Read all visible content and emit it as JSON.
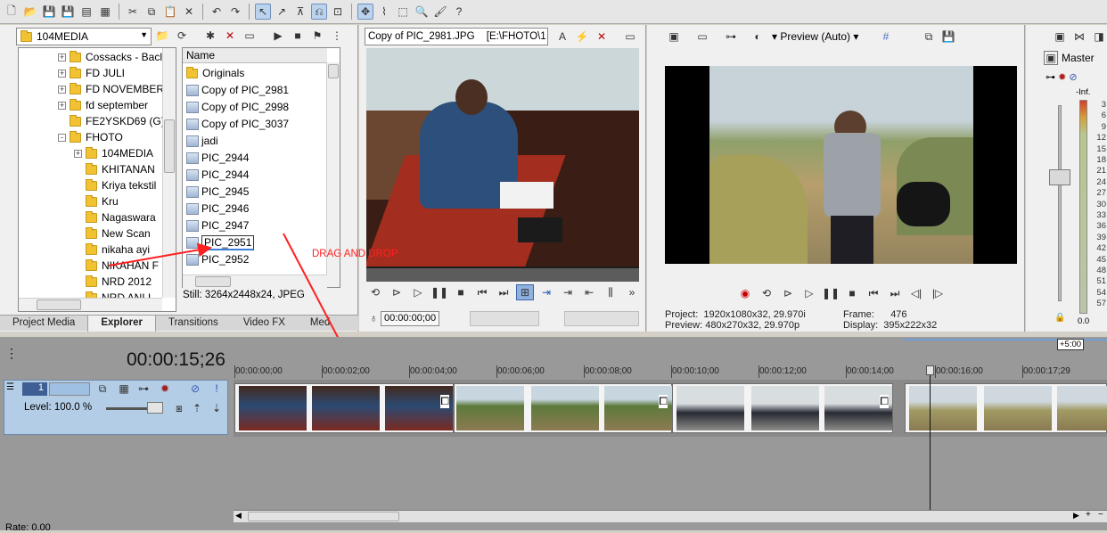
{
  "explorer": {
    "location": "104MEDIA",
    "tree": [
      {
        "label": "Cossacks - Bacl",
        "indent": 1,
        "exp": "+"
      },
      {
        "label": "FD JULI",
        "indent": 1,
        "exp": "+"
      },
      {
        "label": "FD NOVEMBER",
        "indent": 1,
        "exp": "+"
      },
      {
        "label": "fd september",
        "indent": 1,
        "exp": "+"
      },
      {
        "label": "FE2YSKD69 (G)",
        "indent": 1,
        "exp": ""
      },
      {
        "label": "FHOTO",
        "indent": 1,
        "exp": "-"
      },
      {
        "label": "104MEDIA",
        "indent": 2,
        "exp": "+"
      },
      {
        "label": "KHITANAN",
        "indent": 2,
        "exp": ""
      },
      {
        "label": "Kriya tekstil",
        "indent": 2,
        "exp": ""
      },
      {
        "label": "Kru",
        "indent": 2,
        "exp": ""
      },
      {
        "label": "Nagaswara",
        "indent": 2,
        "exp": ""
      },
      {
        "label": "New Scan",
        "indent": 2,
        "exp": ""
      },
      {
        "label": "nikaha ayi",
        "indent": 2,
        "exp": ""
      },
      {
        "label": "NIKAHAN F",
        "indent": 2,
        "exp": ""
      },
      {
        "label": "NRD 2012",
        "indent": 2,
        "exp": ""
      },
      {
        "label": "NRD ANLL",
        "indent": 2,
        "exp": ""
      }
    ],
    "list_header": "Name",
    "files": [
      "Originals",
      "Copy of PIC_2981",
      "Copy of PIC_2998",
      "Copy of PIC_3037",
      "jadi",
      "PIC_2944",
      "PIC_2944",
      "PIC_2945",
      "PIC_2946",
      "PIC_2947",
      "PIC_2951",
      "PIC_2952"
    ],
    "selected_file": "PIC_2951",
    "status": "Still: 3264x2448x24, JPEG",
    "tabs": [
      "Project Media",
      "Explorer",
      "Transitions",
      "Video FX",
      "Med"
    ]
  },
  "trimmer": {
    "title": "Copy of PIC_2981.JPG",
    "path": "[E:\\FHOTO\\1",
    "timecode": "00:00:00;00"
  },
  "preview": {
    "mode": "Preview (Auto)",
    "project_label": "Project:",
    "project": "1920x1080x32, 29.970i",
    "preview_label": "Preview:",
    "preview": "480x270x32, 29.970p",
    "frame_label": "Frame:",
    "frame": "476",
    "display_label": "Display:",
    "display": "395x222x32"
  },
  "master": {
    "label": "Master",
    "inf": "-Inf.",
    "scale": [
      "3",
      "6",
      "9",
      "12",
      "15",
      "18",
      "21",
      "24",
      "27",
      "30",
      "33",
      "36",
      "39",
      "42",
      "45",
      "48",
      "51",
      "54",
      "57"
    ],
    "bottom": "0.0"
  },
  "annotation": {
    "text": "DRAG AND DROP",
    "color": "#ff2020"
  },
  "timeline": {
    "timecode": "00:00:15;26",
    "track_number": "1",
    "level_label": "Level: 100.0 %",
    "rate": "Rate: 0.00",
    "region_length": "+5:00",
    "ruler": [
      "00:00:00;00",
      "00:00:02;00",
      "00:00:04;00",
      "00:00:06;00",
      "00:00:08;00",
      "00:00:10;00",
      "00:00:12;00",
      "00:00:14;00",
      "00:00:16;00",
      "00:00:17;29"
    ]
  }
}
